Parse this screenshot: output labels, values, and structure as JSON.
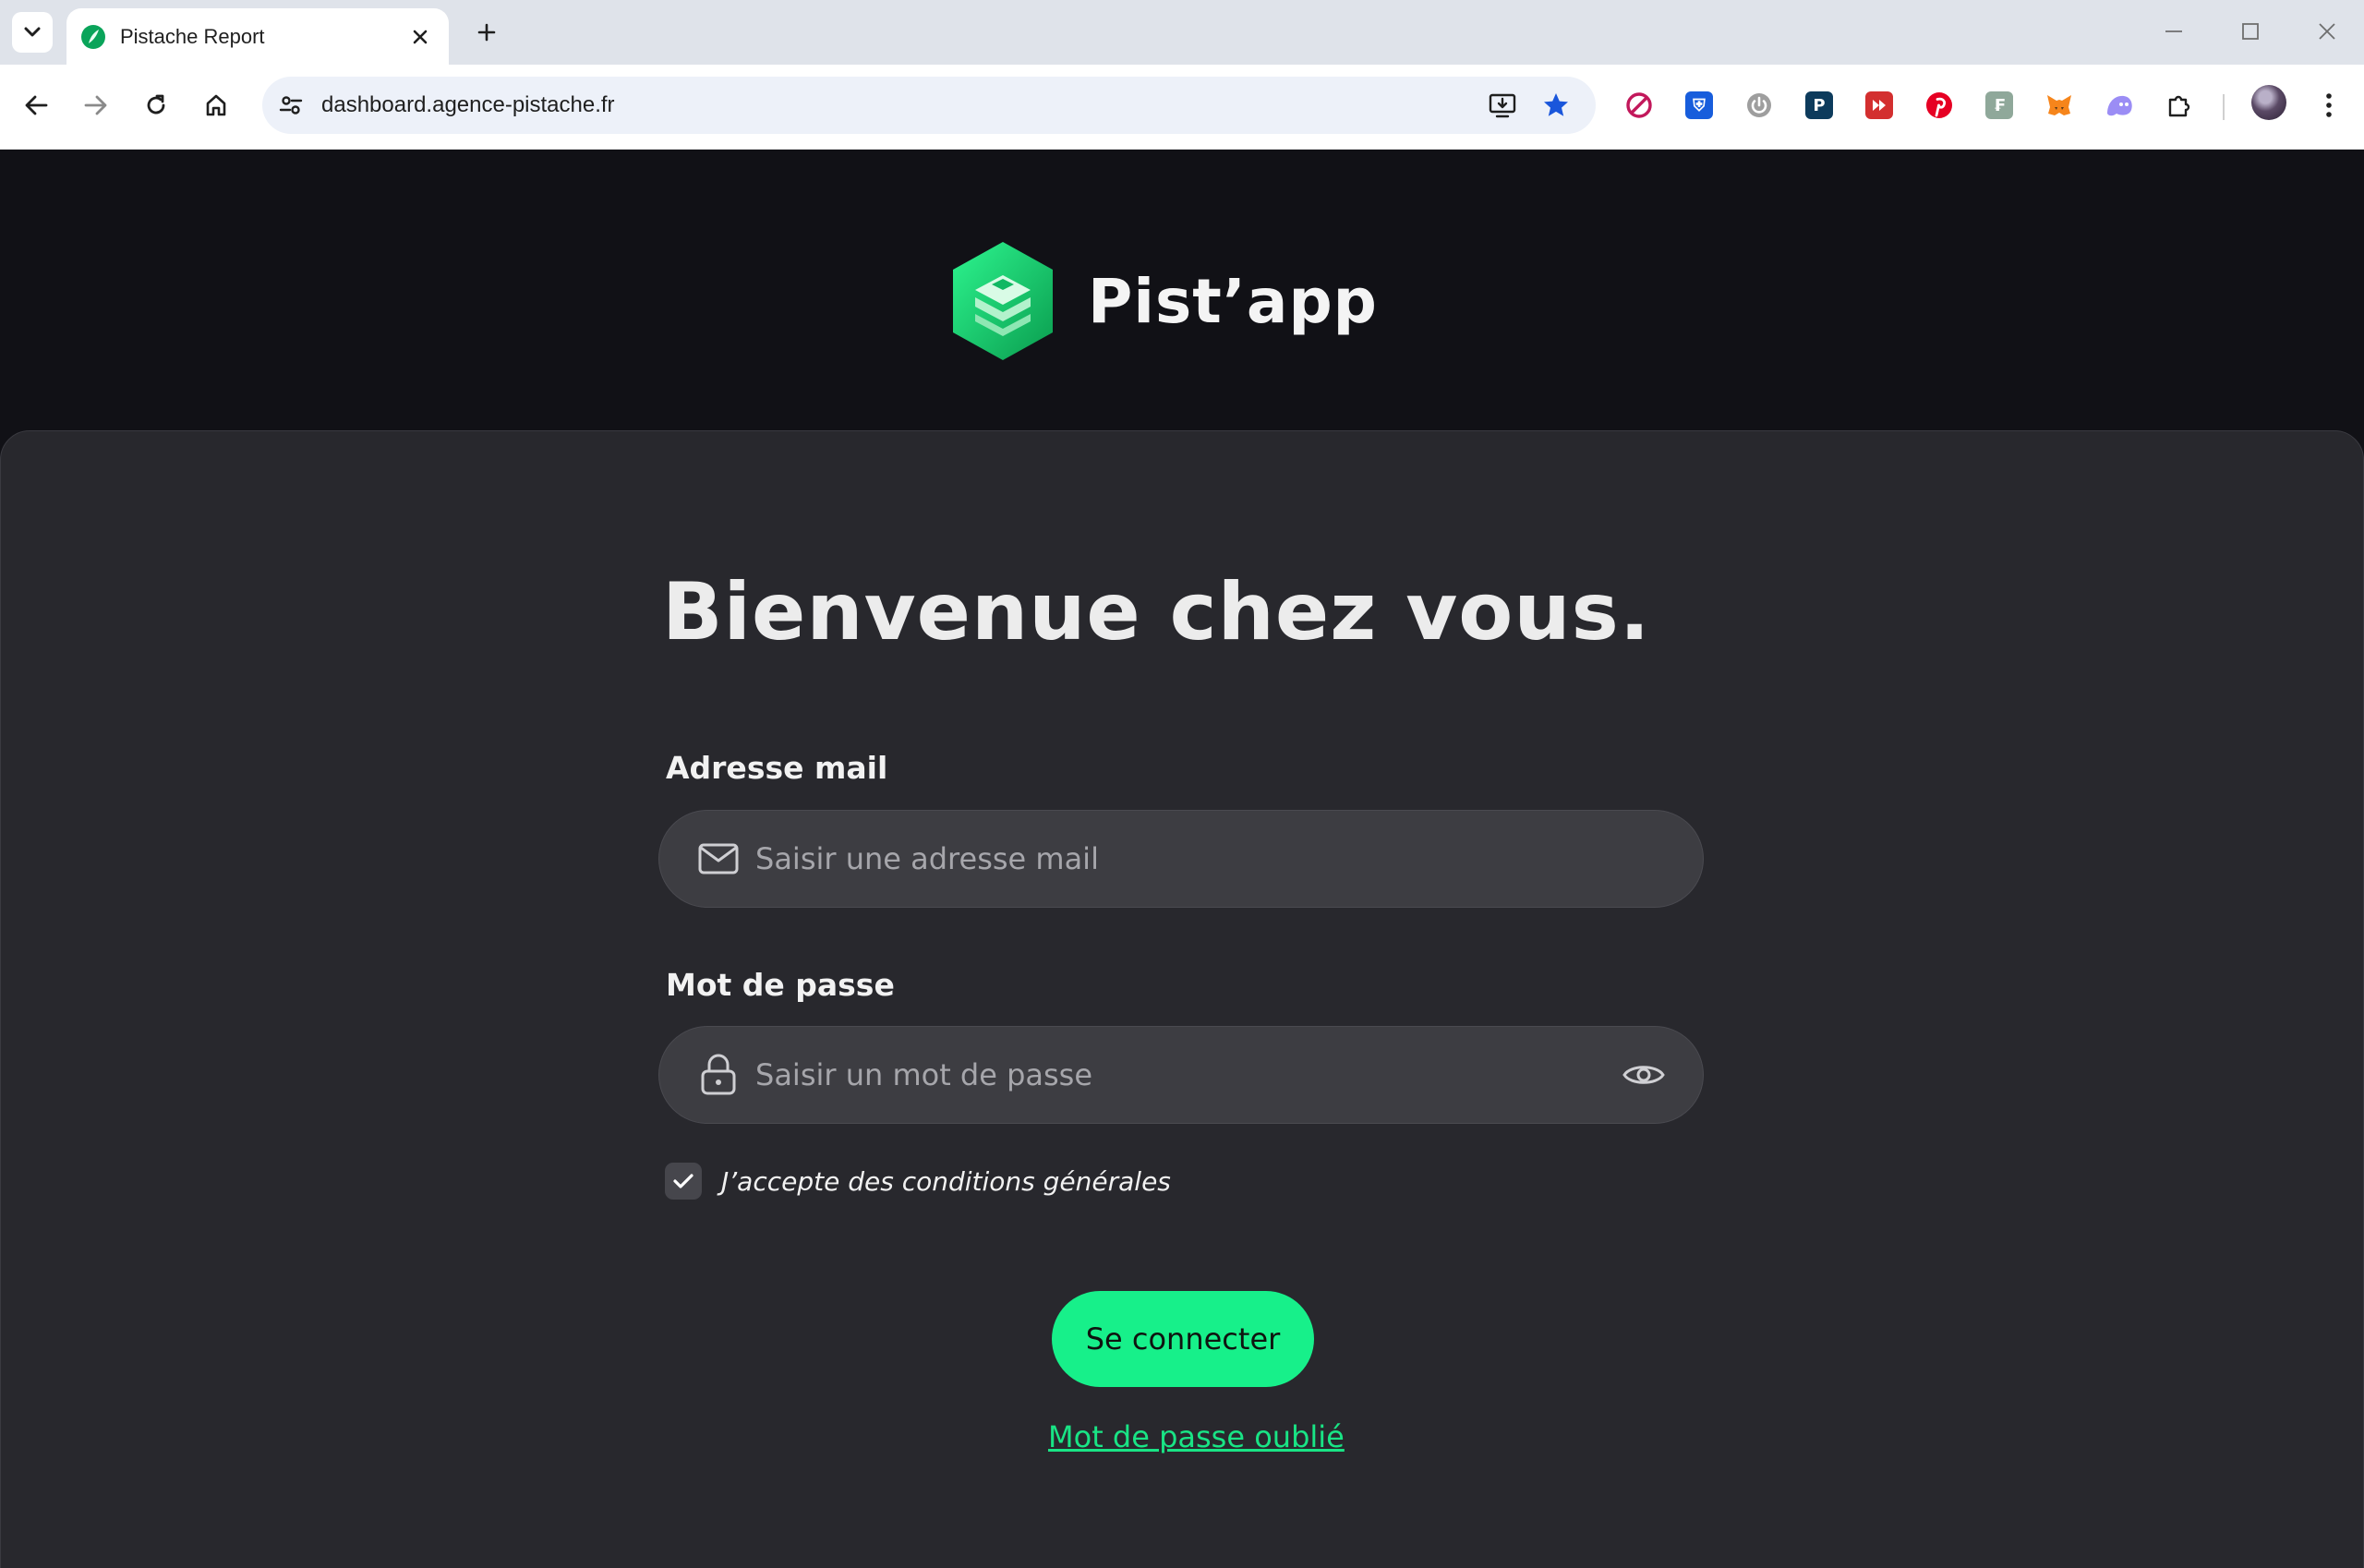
{
  "browser": {
    "tab_title": "Pistache Report",
    "url": "dashboard.agence-pistache.fr",
    "icons": {
      "tab_list": "chevron-down-icon",
      "tab_close": "close-icon",
      "new_tab": "plus-icon",
      "back": "arrow-left-icon",
      "forward": "arrow-right-icon",
      "reload": "reload-icon",
      "home": "home-icon",
      "site_info": "tune-icon",
      "install": "install-app-icon",
      "bookmark": "star-icon",
      "extensions": "puzzle-icon",
      "menu": "kebab-menu-icon"
    },
    "extensions": [
      "blocker-icon",
      "bitwarden-icon",
      "power-icon",
      "p-badge-icon",
      "forward-badge-icon",
      "pinterest-icon",
      "translate-icon",
      "metamask-icon",
      "ghost-icon"
    ],
    "colors": {
      "accent": "#1a73e8"
    }
  },
  "app": {
    "brand_name": "Pist’app",
    "heading": "Bienvenue chez vous.",
    "email": {
      "label": "Adresse mail",
      "placeholder": "Saisir une adresse mail",
      "value": "",
      "icon": "mail-icon"
    },
    "password": {
      "label": "Mot de passe",
      "placeholder": "Saisir un mot de passe",
      "value": "",
      "icon": "lock-icon",
      "toggle_icon": "eye-icon"
    },
    "terms": {
      "label": "J’accepte des conditions générales",
      "checked": true
    },
    "submit_label": "Se connecter",
    "forgot_label": "Mot de passe oublié",
    "colors": {
      "primary": "#17f08a",
      "background": "#111116",
      "card": "#28282d",
      "input": "#3d3d42"
    }
  }
}
